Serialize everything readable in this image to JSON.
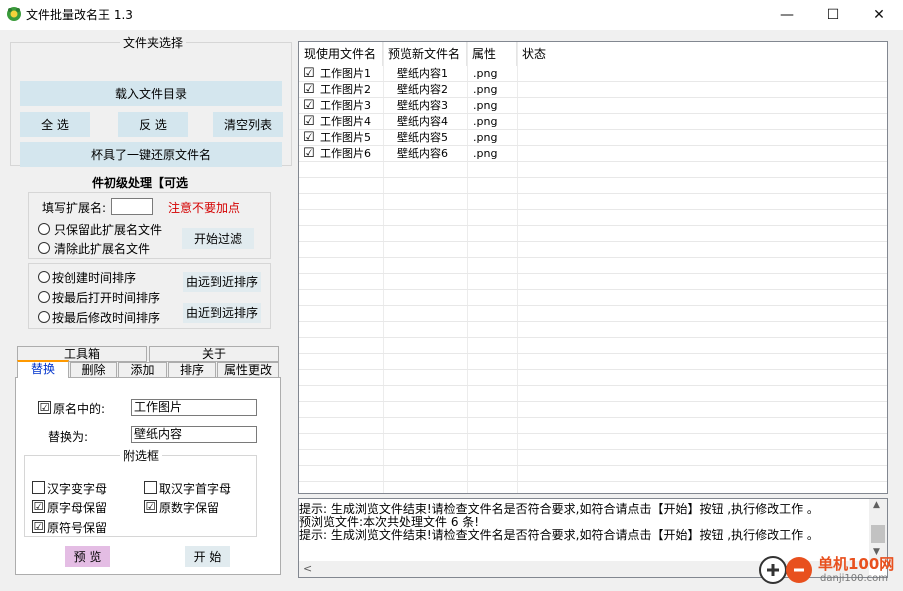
{
  "window": {
    "title": "文件批量改名王  1.3",
    "minimize": "—",
    "maximize": "☐",
    "close": "✕"
  },
  "folder_select": {
    "group_title": "文件夹选择",
    "load_button": "载入文件目录",
    "select_all_button": "全 选",
    "invert_button": "反 选",
    "clear_button": "清空列表",
    "restore_button": "杯具了一键还原文件名"
  },
  "ext_filter": {
    "group_title": "件初级处理【可选",
    "ext_label": "填写扩展名:",
    "ext_value": "",
    "warning": "注意不要加点",
    "radio_keep": "只保留此扩展名文件",
    "radio_remove": "清除此扩展名文件",
    "filter_button": "开始过滤"
  },
  "sort": {
    "radio_created": "按创建时间排序",
    "radio_opened": "按最后打开时间排序",
    "radio_modified": "按最后修改时间排序",
    "far_to_near": "由远到近排序",
    "near_to_far": "由近到远排序"
  },
  "tabs": {
    "row1": [
      "工具箱",
      "关于"
    ],
    "row2": [
      "替换",
      "删除",
      "添加",
      "排序",
      "属性更改"
    ]
  },
  "replace": {
    "original_check": "☑",
    "original_label": "原名中的:",
    "original_value": "工作图片",
    "replace_label": "替换为:",
    "replace_value": "壁纸内容",
    "options_title": "附选框",
    "opt_hanzi": "汉字变字母",
    "opt_first_letter": "取汉字首字母",
    "opt_keep_letters": "原字母保留",
    "opt_keep_digits": "原数字保留",
    "opt_keep_symbols": "原符号保留",
    "preview_button": "预 览",
    "start_button": "开 始"
  },
  "file_list": {
    "headers": [
      "现使用文件名",
      "预览新文件名",
      "属性",
      "状态"
    ],
    "rows": [
      {
        "check": "☑",
        "current": "工作图片1",
        "preview": "壁纸内容1",
        "ext": ".png",
        "status": ""
      },
      {
        "check": "☑",
        "current": "工作图片2",
        "preview": "壁纸内容2",
        "ext": ".png",
        "status": ""
      },
      {
        "check": "☑",
        "current": "工作图片3",
        "preview": "壁纸内容3",
        "ext": ".png",
        "status": ""
      },
      {
        "check": "☑",
        "current": "工作图片4",
        "preview": "壁纸内容4",
        "ext": ".png",
        "status": ""
      },
      {
        "check": "☑",
        "current": "工作图片5",
        "preview": "壁纸内容5",
        "ext": ".png",
        "status": ""
      },
      {
        "check": "☑",
        "current": "工作图片6",
        "preview": "壁纸内容6",
        "ext": ".png",
        "status": ""
      }
    ]
  },
  "log": {
    "lines": [
      "提示:  生成浏览文件结束!请检查文件名是否符合要求,如符合请点击【开始】按钮 ,执行修改工作 。",
      "预浏览文件:本次共处理文件 6 条!",
      "提示:  生成浏览文件结束!请检查文件名是否符合要求,如符合请点击【开始】按钮 ,执行修改工作 。"
    ],
    "scroll_up": "▲",
    "scroll_down": "▼",
    "scroll_left": "<"
  },
  "watermark": {
    "text": "单机100网",
    "url_text": "danji100.com"
  }
}
